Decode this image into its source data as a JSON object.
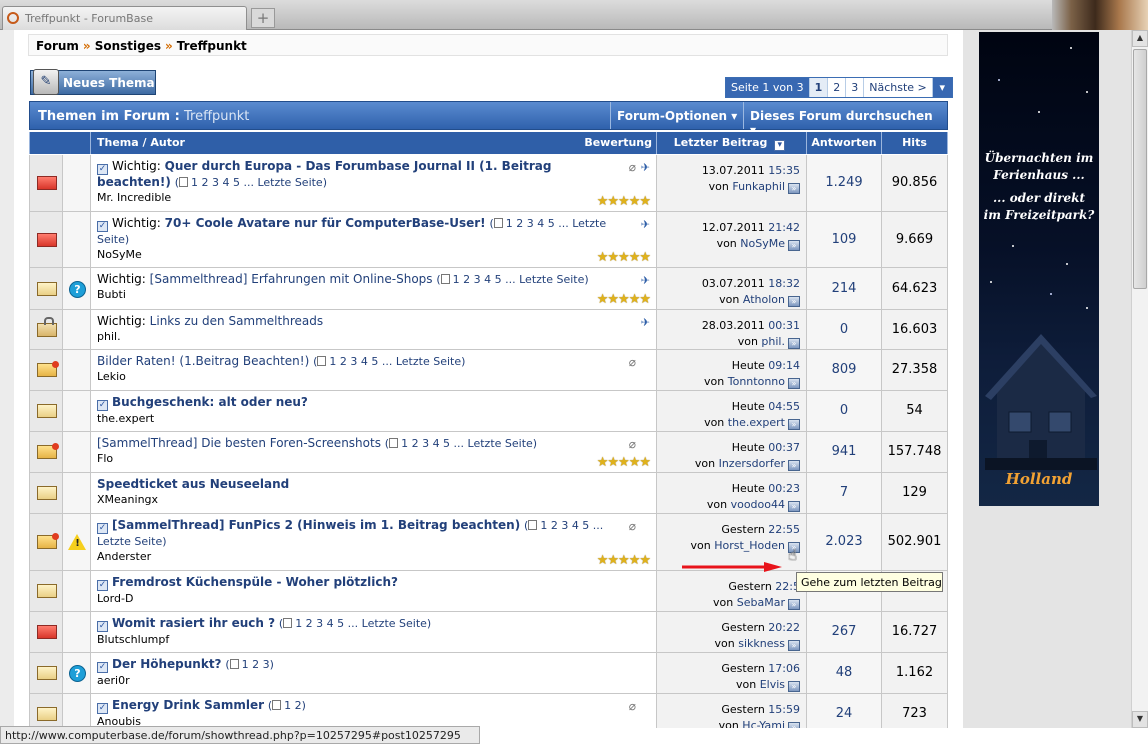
{
  "browser": {
    "tab_title": "Treffpunkt - ForumBase",
    "new_tab": "+",
    "status_url": "http://www.computerbase.de/forum/showthread.php?p=10257295#post10257295"
  },
  "breadcrumb": [
    "Forum",
    "Sonstiges",
    "Treffpunkt"
  ],
  "breadcrumb_sep": "»",
  "new_thread_label": "Neues Thema",
  "pagenav": {
    "current": "Seite 1 von 3",
    "pages": [
      "1",
      "2",
      "3"
    ],
    "next": "Nächste >",
    "dropdown": "▾"
  },
  "forum_header": {
    "label": "Themen im Forum :",
    "forum": "Treffpunkt",
    "options": "Forum-Optionen ▾",
    "search": "Dieses Forum durchsuchen ▾"
  },
  "columns": {
    "thread": "Thema / Autor",
    "rating": "Bewertung",
    "last_post": "Letzter Beitrag",
    "replies": "Antworten",
    "hits": "Hits"
  },
  "icons": {
    "thread_read": "envelope-icon",
    "question": "question-icon",
    "warning": "warning-icon",
    "attachment": "paperclip-icon",
    "sticky": "pin-icon",
    "go_to_last": "go-to-last-post-icon",
    "page": "page-icon",
    "check": "checkmark-icon"
  },
  "colors": {
    "link": "#22407a",
    "header": "#2f5fa8",
    "star": "#e0b21b",
    "arrow": "#e8141b"
  },
  "threads": [
    {
      "prefix": "Wichtig:",
      "title": "Quer durch Europa - Das Forumbase Journal II (1. Beitrag beachten!)",
      "pages": "1 2 3 4 5 ... Letzte Seite",
      "author": "Mr. Incredible",
      "date": "13.07.2011",
      "time": "15:35",
      "by": "Funkaphil",
      "replies": "1.249",
      "hits": "90.856",
      "stars": 5
    },
    {
      "prefix": "Wichtig:",
      "title": "70+ Coole Avatare nur für ComputerBase-User!",
      "pages": "1 2 3 4 5 ... Letzte Seite",
      "author": "NoSyMe",
      "date": "12.07.2011",
      "time": "21:42",
      "by": "NoSyMe",
      "replies": "109",
      "hits": "9.669",
      "stars": 5
    },
    {
      "prefix": "Wichtig:",
      "title": "[Sammelthread] Erfahrungen mit Online-Shops",
      "pages": "1 2 3 4 5 ... Letzte Seite",
      "author": "Bubti",
      "date": "03.07.2011",
      "time": "18:32",
      "by": "Atholon",
      "replies": "214",
      "hits": "64.623",
      "stars": 5
    },
    {
      "prefix": "Wichtig:",
      "title": "Links zu den Sammelthreads",
      "pages": "",
      "author": "phil.",
      "date": "28.03.2011",
      "time": "00:31",
      "by": "phil.",
      "replies": "0",
      "hits": "16.603",
      "stars": 0
    },
    {
      "prefix": "",
      "title": "Bilder Raten! (1.Beitrag Beachten!)",
      "pages": "1 2 3 4 5 ... Letzte Seite",
      "author": "Lekio",
      "date": "Heute",
      "time": "09:14",
      "by": "Tonntonno",
      "replies": "809",
      "hits": "27.358",
      "stars": 0
    },
    {
      "prefix": "",
      "title": "Buchgeschenk: alt oder neu?",
      "pages": "",
      "author": "the.expert",
      "date": "Heute",
      "time": "04:55",
      "by": "the.expert",
      "replies": "0",
      "hits": "54",
      "stars": 0
    },
    {
      "prefix": "",
      "title": "[SammelThread] Die besten Foren-Screenshots",
      "pages": "1 2 3 4 5 ... Letzte Seite",
      "author": "Flo",
      "date": "Heute",
      "time": "00:37",
      "by": "Inzersdorfer",
      "replies": "941",
      "hits": "157.748",
      "stars": 5
    },
    {
      "prefix": "",
      "title": "Speedticket aus Neuseeland",
      "pages": "",
      "author": "XMeaningx",
      "date": "Heute",
      "time": "00:23",
      "by": "voodoo44",
      "replies": "7",
      "hits": "129",
      "stars": 0
    },
    {
      "prefix": "",
      "title": "[SammelThread] FunPics 2 (Hinweis im 1. Beitrag beachten)",
      "pages": "1 2 3 4 5 ... Letzte Seite",
      "author": "Anderster",
      "date": "Gestern",
      "time": "22:55",
      "by": "Horst_Hoden",
      "replies": "2.023",
      "hits": "502.901",
      "stars": 5
    },
    {
      "prefix": "",
      "title": "Fremdrost Küchenspüle - Woher plötzlich?",
      "pages": "",
      "author": "Lord-D",
      "date": "Gestern",
      "time": "22:5",
      "by": "SebaMar",
      "replies": "",
      "hits": "",
      "stars": 0
    },
    {
      "prefix": "",
      "title": "Womit rasiert ihr euch ?",
      "pages": "1 2 3 4 5 ... Letzte Seite",
      "author": "Blutschlumpf",
      "date": "Gestern",
      "time": "20:22",
      "by": "sikkness",
      "replies": "267",
      "hits": "16.727",
      "stars": 0
    },
    {
      "prefix": "",
      "title": "Der Höhepunkt?",
      "pages": "1 2 3",
      "author": "aeri0r",
      "date": "Gestern",
      "time": "17:06",
      "by": "Elvis",
      "replies": "48",
      "hits": "1.162",
      "stars": 0
    },
    {
      "prefix": "",
      "title": "Energy Drink Sammler",
      "pages": "1 2",
      "author": "Anoubis",
      "date": "Gestern",
      "time": "15:59",
      "by": "Hc-Yami",
      "replies": "24",
      "hits": "723",
      "stars": 0
    }
  ],
  "by_label": "von",
  "tooltip": "Gehe zum letzten Beitrag",
  "ad": {
    "line1": "Übernachten im",
    "line2": "Ferienhaus ...",
    "line3": "... oder direkt",
    "line4": "im Freizeitpark?",
    "logo": "Holland"
  }
}
